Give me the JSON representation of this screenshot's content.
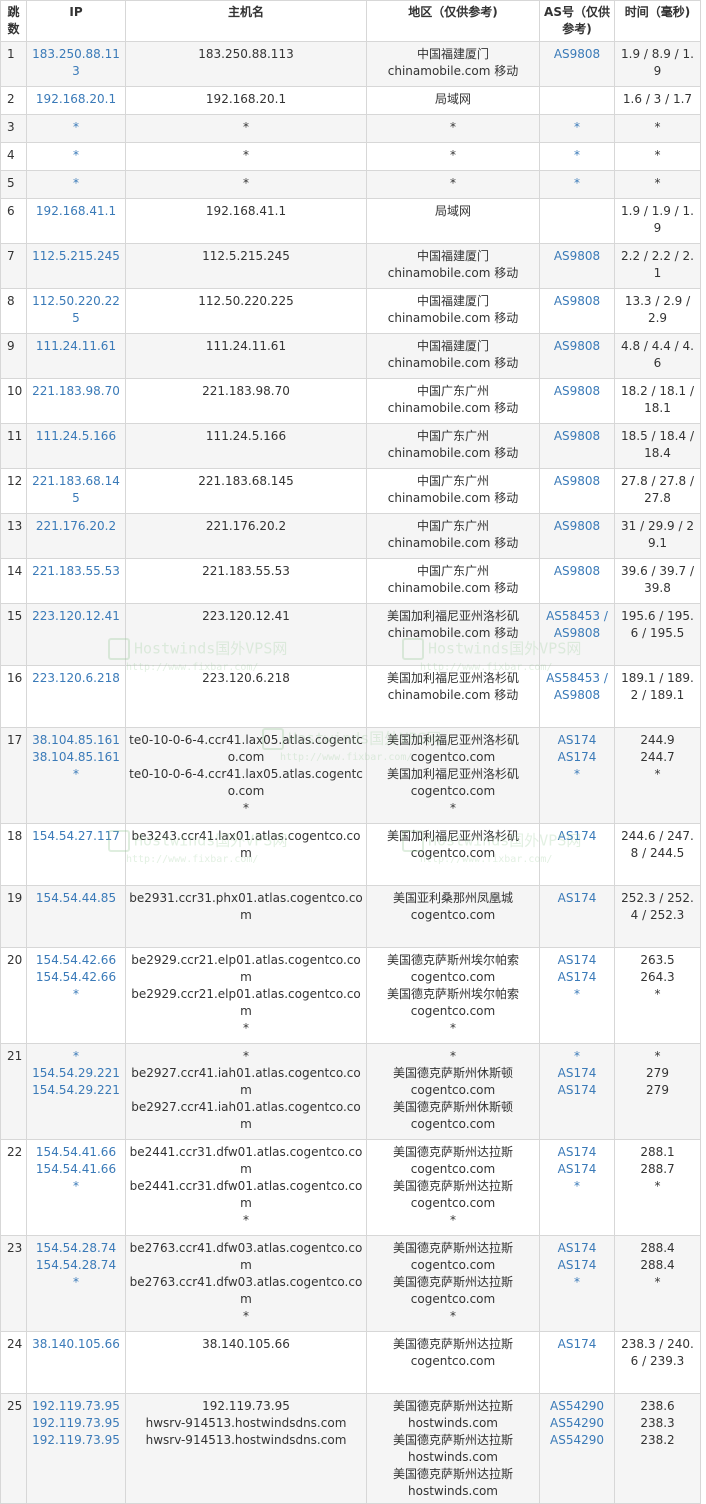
{
  "headers": {
    "hop": "跳数",
    "ip": "IP",
    "hostname": "主机名",
    "region": "地区（仅供参考)",
    "asn": "AS号（仅供参考)",
    "time": "时间（毫秒)"
  },
  "rows": [
    {
      "hop": "1",
      "ip": [
        "183.250.88.113"
      ],
      "host": [
        "183.250.88.113"
      ],
      "region": [
        "中国福建厦门",
        "chinamobile.com 移动"
      ],
      "asn": [
        "AS9808"
      ],
      "time": [
        "1.9 / 8.9 / 1.9"
      ]
    },
    {
      "hop": "2",
      "ip": [
        "192.168.20.1"
      ],
      "host": [
        "192.168.20.1"
      ],
      "region": [
        "局域网"
      ],
      "asn": [
        ""
      ],
      "time": [
        "1.6 / 3 / 1.7"
      ]
    },
    {
      "hop": "3",
      "ip": [
        "*"
      ],
      "host": [
        "*"
      ],
      "region": [
        "*"
      ],
      "asn": [
        "*"
      ],
      "time": [
        "*"
      ]
    },
    {
      "hop": "4",
      "ip": [
        "*"
      ],
      "host": [
        "*"
      ],
      "region": [
        "*"
      ],
      "asn": [
        "*"
      ],
      "time": [
        "*"
      ]
    },
    {
      "hop": "5",
      "ip": [
        "*"
      ],
      "host": [
        "*"
      ],
      "region": [
        "*"
      ],
      "asn": [
        "*"
      ],
      "time": [
        "*"
      ]
    },
    {
      "hop": "6",
      "ip": [
        "192.168.41.1"
      ],
      "host": [
        "192.168.41.1"
      ],
      "region": [
        "局域网"
      ],
      "asn": [
        ""
      ],
      "time": [
        "1.9 / 1.9 / 1.9"
      ]
    },
    {
      "hop": "7",
      "ip": [
        "112.5.215.245"
      ],
      "host": [
        "112.5.215.245"
      ],
      "region": [
        "中国福建厦门",
        "chinamobile.com 移动"
      ],
      "asn": [
        "AS9808"
      ],
      "time": [
        "2.2 / 2.2 / 2.1"
      ]
    },
    {
      "hop": "8",
      "ip": [
        "112.50.220.225"
      ],
      "host": [
        "112.50.220.225"
      ],
      "region": [
        "中国福建厦门",
        "chinamobile.com 移动"
      ],
      "asn": [
        "AS9808"
      ],
      "time": [
        "13.3 / 2.9 / 2.9"
      ]
    },
    {
      "hop": "9",
      "ip": [
        "111.24.11.61"
      ],
      "host": [
        "111.24.11.61"
      ],
      "region": [
        "中国福建厦门",
        "chinamobile.com 移动"
      ],
      "asn": [
        "AS9808"
      ],
      "time": [
        "4.8 / 4.4 / 4.6"
      ]
    },
    {
      "hop": "10",
      "ip": [
        "221.183.98.70"
      ],
      "host": [
        "221.183.98.70"
      ],
      "region": [
        "中国广东广州",
        "chinamobile.com 移动"
      ],
      "asn": [
        "AS9808"
      ],
      "time": [
        "18.2 / 18.1 / 18.1"
      ]
    },
    {
      "hop": "11",
      "ip": [
        "111.24.5.166"
      ],
      "host": [
        "111.24.5.166"
      ],
      "region": [
        "中国广东广州",
        "chinamobile.com 移动"
      ],
      "asn": [
        "AS9808"
      ],
      "time": [
        "18.5 / 18.4 / 18.4"
      ]
    },
    {
      "hop": "12",
      "ip": [
        "221.183.68.145"
      ],
      "host": [
        "221.183.68.145"
      ],
      "region": [
        "中国广东广州",
        "chinamobile.com 移动"
      ],
      "asn": [
        "AS9808"
      ],
      "time": [
        "27.8 / 27.8 / 27.8"
      ]
    },
    {
      "hop": "13",
      "ip": [
        "221.176.20.2"
      ],
      "host": [
        "221.176.20.2"
      ],
      "region": [
        "中国广东广州",
        "chinamobile.com 移动"
      ],
      "asn": [
        "AS9808"
      ],
      "time": [
        "31 / 29.9 / 29.1"
      ]
    },
    {
      "hop": "14",
      "ip": [
        "221.183.55.53"
      ],
      "host": [
        "221.183.55.53"
      ],
      "region": [
        "中国广东广州",
        "chinamobile.com 移动"
      ],
      "asn": [
        "AS9808"
      ],
      "time": [
        "39.6 / 39.7 / 39.8"
      ]
    },
    {
      "hop": "15",
      "ip": [
        "223.120.12.41"
      ],
      "host": [
        "223.120.12.41"
      ],
      "region": [
        "美国加利福尼亚州洛杉矶",
        "chinamobile.com 移动"
      ],
      "asn": [
        "AS58453 / AS9808"
      ],
      "time": [
        "195.6 / 195.6 / 195.5"
      ]
    },
    {
      "hop": "16",
      "ip": [
        "223.120.6.218"
      ],
      "host": [
        "223.120.6.218"
      ],
      "region": [
        "美国加利福尼亚州洛杉矶",
        "chinamobile.com 移动"
      ],
      "asn": [
        "AS58453 / AS9808"
      ],
      "time": [
        "189.1 / 189.2 / 189.1"
      ]
    },
    {
      "hop": "17",
      "ip": [
        "38.104.85.161",
        "38.104.85.161",
        "*"
      ],
      "host": [
        "te0-10-0-6-4.ccr41.lax05.atlas.cogentco.com",
        "te0-10-0-6-4.ccr41.lax05.atlas.cogentco.com",
        "*"
      ],
      "region": [
        "美国加利福尼亚州洛杉矶",
        "cogentco.com",
        "美国加利福尼亚州洛杉矶",
        "cogentco.com",
        "*"
      ],
      "asn": [
        "AS174",
        "AS174",
        "*"
      ],
      "time": [
        "244.9",
        "244.7",
        "*"
      ]
    },
    {
      "hop": "18",
      "ip": [
        "154.54.27.117"
      ],
      "host": [
        "be3243.ccr41.lax01.atlas.cogentco.com"
      ],
      "region": [
        "美国加利福尼亚州洛杉矶",
        "cogentco.com"
      ],
      "asn": [
        "AS174"
      ],
      "time": [
        "244.6 / 247.8 / 244.5"
      ]
    },
    {
      "hop": "19",
      "ip": [
        "154.54.44.85"
      ],
      "host": [
        "be2931.ccr31.phx01.atlas.cogentco.com"
      ],
      "region": [
        "美国亚利桑那州凤凰城",
        "cogentco.com"
      ],
      "asn": [
        "AS174"
      ],
      "time": [
        "252.3 / 252.4 / 252.3"
      ]
    },
    {
      "hop": "20",
      "ip": [
        "154.54.42.66",
        "154.54.42.66",
        "*"
      ],
      "host": [
        "be2929.ccr21.elp01.atlas.cogentco.com",
        "be2929.ccr21.elp01.atlas.cogentco.com",
        "*"
      ],
      "region": [
        "美国德克萨斯州埃尔帕索",
        "cogentco.com",
        "美国德克萨斯州埃尔帕索",
        "cogentco.com",
        "*"
      ],
      "asn": [
        "AS174",
        "AS174",
        "*"
      ],
      "time": [
        "263.5",
        "264.3",
        "*"
      ]
    },
    {
      "hop": "21",
      "ip": [
        "*",
        "154.54.29.221",
        "154.54.29.221"
      ],
      "host": [
        "*",
        "be2927.ccr41.iah01.atlas.cogentco.com",
        "be2927.ccr41.iah01.atlas.cogentco.com"
      ],
      "region": [
        "*",
        "美国德克萨斯州休斯顿",
        "cogentco.com",
        "美国德克萨斯州休斯顿",
        "cogentco.com"
      ],
      "asn": [
        "*",
        "AS174",
        "AS174"
      ],
      "time": [
        "*",
        "279",
        "279"
      ]
    },
    {
      "hop": "22",
      "ip": [
        "154.54.41.66",
        "154.54.41.66",
        "*"
      ],
      "host": [
        "be2441.ccr31.dfw01.atlas.cogentco.com",
        "be2441.ccr31.dfw01.atlas.cogentco.com",
        "*"
      ],
      "region": [
        "美国德克萨斯州达拉斯",
        "cogentco.com",
        "美国德克萨斯州达拉斯",
        "cogentco.com",
        "*"
      ],
      "asn": [
        "AS174",
        "AS174",
        "*"
      ],
      "time": [
        "288.1",
        "288.7",
        "*"
      ]
    },
    {
      "hop": "23",
      "ip": [
        "154.54.28.74",
        "154.54.28.74",
        "*"
      ],
      "host": [
        "be2763.ccr41.dfw03.atlas.cogentco.com",
        "be2763.ccr41.dfw03.atlas.cogentco.com",
        "*"
      ],
      "region": [
        "美国德克萨斯州达拉斯",
        "cogentco.com",
        "美国德克萨斯州达拉斯",
        "cogentco.com",
        "*"
      ],
      "asn": [
        "AS174",
        "AS174",
        "*"
      ],
      "time": [
        "288.4",
        "288.4",
        "*"
      ]
    },
    {
      "hop": "24",
      "ip": [
        "38.140.105.66"
      ],
      "host": [
        "38.140.105.66"
      ],
      "region": [
        "美国德克萨斯州达拉斯",
        "cogentco.com"
      ],
      "asn": [
        "AS174"
      ],
      "time": [
        "238.3 / 240.6 / 239.3"
      ]
    },
    {
      "hop": "25",
      "ip": [
        "192.119.73.95",
        "192.119.73.95",
        "192.119.73.95"
      ],
      "host": [
        "192.119.73.95",
        "hwsrv-914513.hostwindsdns.com",
        "hwsrv-914513.hostwindsdns.com"
      ],
      "region": [
        "美国德克萨斯州达拉斯",
        "hostwinds.com",
        "美国德克萨斯州达拉斯",
        "hostwinds.com",
        "美国德克萨斯州达拉斯",
        "hostwinds.com"
      ],
      "asn": [
        "AS54290",
        "AS54290",
        "AS54290"
      ],
      "time": [
        "238.6",
        "238.3",
        "238.2"
      ]
    }
  ],
  "watermark": {
    "title": "Hostwinds国外VPS网",
    "url": "http://www.fixbar.com/"
  }
}
